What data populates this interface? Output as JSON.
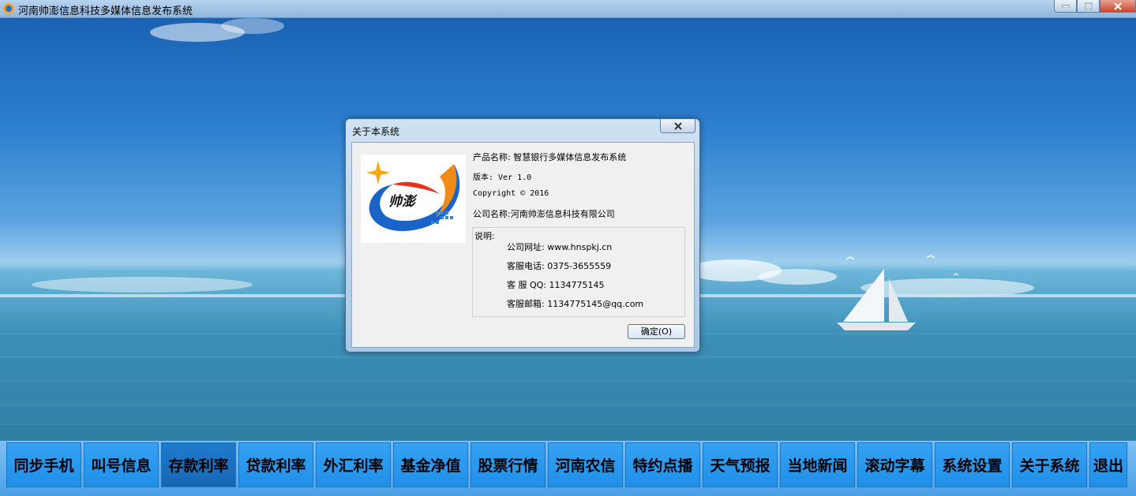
{
  "window": {
    "title": "河南帅澎信息科技多媒体信息发布系统"
  },
  "dialog": {
    "title": "关于本系统",
    "product_line": "产品名称: 智慧银行多媒体信息发布系统",
    "version_line": "版本: Ver 1.0",
    "copyright_line": "Copyright ©  2016",
    "company_line": "公司名称:河南帅澎信息科技有限公司",
    "desc_title": "说明:",
    "desc_lines": [
      "公司网址: www.hnspkj.cn",
      "客服电话: 0375-3655559",
      "客 服 QQ: 1134775145",
      "客服邮箱: 1134775145@qq.com"
    ],
    "ok_label": "确定(O)",
    "logo_text": "帅澎"
  },
  "toolbar": {
    "buttons": [
      "同步手机",
      "叫号信息",
      "存款利率",
      "贷款利率",
      "外汇利率",
      "基金净值",
      "股票行情",
      "河南农信",
      "特约点播",
      "天气预报",
      "当地新闻",
      "滚动字幕",
      "系统设置",
      "关于系统",
      "退出"
    ],
    "active_index": 2
  },
  "colors": {
    "toolbar_button": "#2196f0",
    "toolbar_active": "#1a72c4",
    "accent": "#1f6fc0"
  }
}
